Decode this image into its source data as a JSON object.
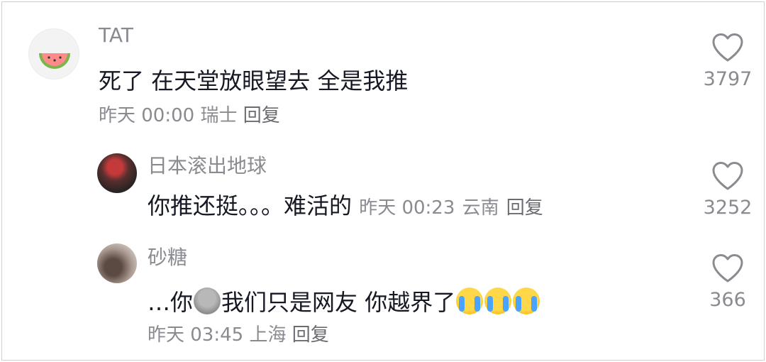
{
  "comments": [
    {
      "username": "TAT",
      "text": "死了 在天堂放眼望去 全是我推",
      "time": "昨天 00:00",
      "location": "瑞士",
      "reply_label": "回复",
      "likes": "3797"
    }
  ],
  "replies": [
    {
      "username": "日本滚出地球",
      "text": "你推还挺。。。难活的",
      "time": "昨天 00:23",
      "location": "云南",
      "reply_label": "回复",
      "likes": "3252"
    },
    {
      "username": "砂糖",
      "text_prefix": "…你",
      "text_middle": "我们只是网友 你越界了",
      "emoji_names": [
        "pigeon-emoji",
        "crying-emoji",
        "crying-emoji",
        "crying-emoji"
      ],
      "time": "昨天 03:45",
      "location": "上海",
      "reply_label": "回复",
      "likes": "366"
    }
  ]
}
